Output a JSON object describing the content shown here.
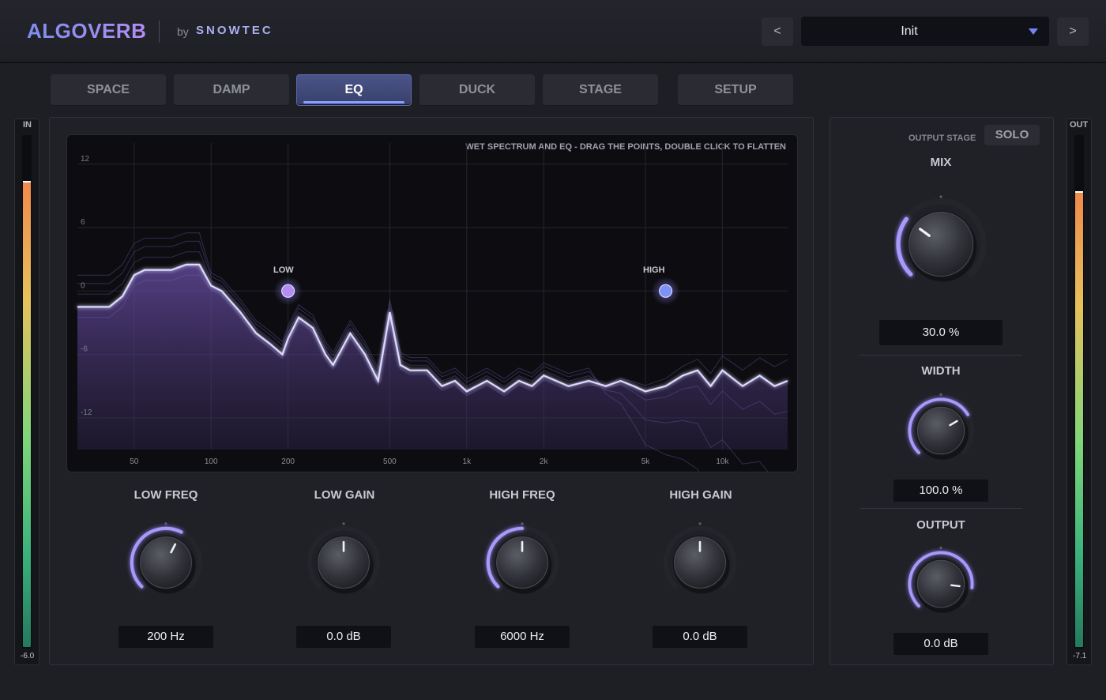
{
  "app": {
    "logo": "ALGOVERB",
    "by": "by",
    "brand": "SNOWTEC"
  },
  "preset": {
    "prev": "<",
    "name": "Init",
    "next": ">"
  },
  "tabs": [
    {
      "label": "SPACE"
    },
    {
      "label": "DAMP"
    },
    {
      "label": "EQ",
      "active": true
    },
    {
      "label": "DUCK"
    },
    {
      "label": "STAGE"
    },
    {
      "label": "SETUP"
    }
  ],
  "meters": {
    "in": {
      "label": "IN",
      "value": "-6.0",
      "level": 0.91
    },
    "out": {
      "label": "OUT",
      "value": "-7.1",
      "level": 0.89
    }
  },
  "eq_graph": {
    "hint": "WET SPECTRUM AND EQ - DRAG THE POINTS, DOUBLE CLICK TO FLATTEN",
    "y_ticks": [
      "12",
      "6",
      "0",
      "-6",
      "-12"
    ],
    "x_ticks": [
      "50",
      "100",
      "200",
      "500",
      "1k",
      "2k",
      "5k",
      "10k"
    ],
    "low_label": "LOW",
    "high_label": "HIGH"
  },
  "chart_data": {
    "type": "line",
    "title": "WET SPECTRUM AND EQ - DRAG THE POINTS, DOUBLE CLICK TO FLATTEN",
    "x_scale": "log",
    "xlim": [
      30,
      18000
    ],
    "ylim": [
      -15,
      14
    ],
    "series": [
      {
        "x": [
          200,
          6000
        ],
        "y": [
          0,
          0
        ]
      },
      {
        "x": [
          30,
          35,
          40,
          45,
          50,
          55,
          60,
          70,
          80,
          90,
          100,
          110,
          130,
          150,
          170,
          190,
          200,
          220,
          250,
          280,
          300,
          350,
          400,
          450,
          500,
          550,
          600,
          700,
          800,
          900,
          1000,
          1200,
          1400,
          1600,
          1800,
          2000,
          2500,
          3000,
          3500,
          4000,
          4500,
          5000,
          6000,
          7000,
          8000,
          9000,
          10000,
          12000,
          14000,
          16000,
          18000
        ],
        "y": [
          -1.5,
          -1.5,
          -1.5,
          -0.5,
          1.5,
          2,
          2,
          2,
          2.5,
          2.5,
          0.5,
          0,
          -2,
          -4,
          -5,
          -6,
          -4.5,
          -2.5,
          -3.5,
          -6,
          -7,
          -4,
          -6,
          -8.5,
          -2,
          -7,
          -7.5,
          -7.5,
          -9,
          -8.5,
          -9.5,
          -8.5,
          -9.5,
          -8.5,
          -9,
          -8,
          -9,
          -8.5,
          -9,
          -8.5,
          -9,
          -9.5,
          -9,
          -8,
          -7.5,
          -9,
          -7.5,
          -9,
          -8,
          -9,
          -8.5
        ]
      }
    ]
  },
  "knobs": {
    "low_freq": {
      "label": "LOW FREQ",
      "value": "200 Hz",
      "pos": 0.6
    },
    "low_gain": {
      "label": "LOW GAIN",
      "value": "0.0 dB",
      "pos": 0.5
    },
    "high_freq": {
      "label": "HIGH FREQ",
      "value": "6000 Hz",
      "pos": 0.5
    },
    "high_gain": {
      "label": "HIGH GAIN",
      "value": "0.0 dB",
      "pos": 0.5
    }
  },
  "output_stage": {
    "title": "OUTPUT STAGE",
    "solo": "SOLO",
    "mix": {
      "label": "MIX",
      "value": "30.0 %",
      "pos": 0.3
    },
    "width": {
      "label": "WIDTH",
      "value": "100.0 %",
      "pos": 0.72
    },
    "output": {
      "label": "OUTPUT",
      "value": "0.0 dB",
      "pos": 0.86
    }
  },
  "colors": {
    "accent": "#8a7cf0",
    "accent2": "#6f86f5",
    "panel": "#202127",
    "bg": "#1e1f25"
  }
}
